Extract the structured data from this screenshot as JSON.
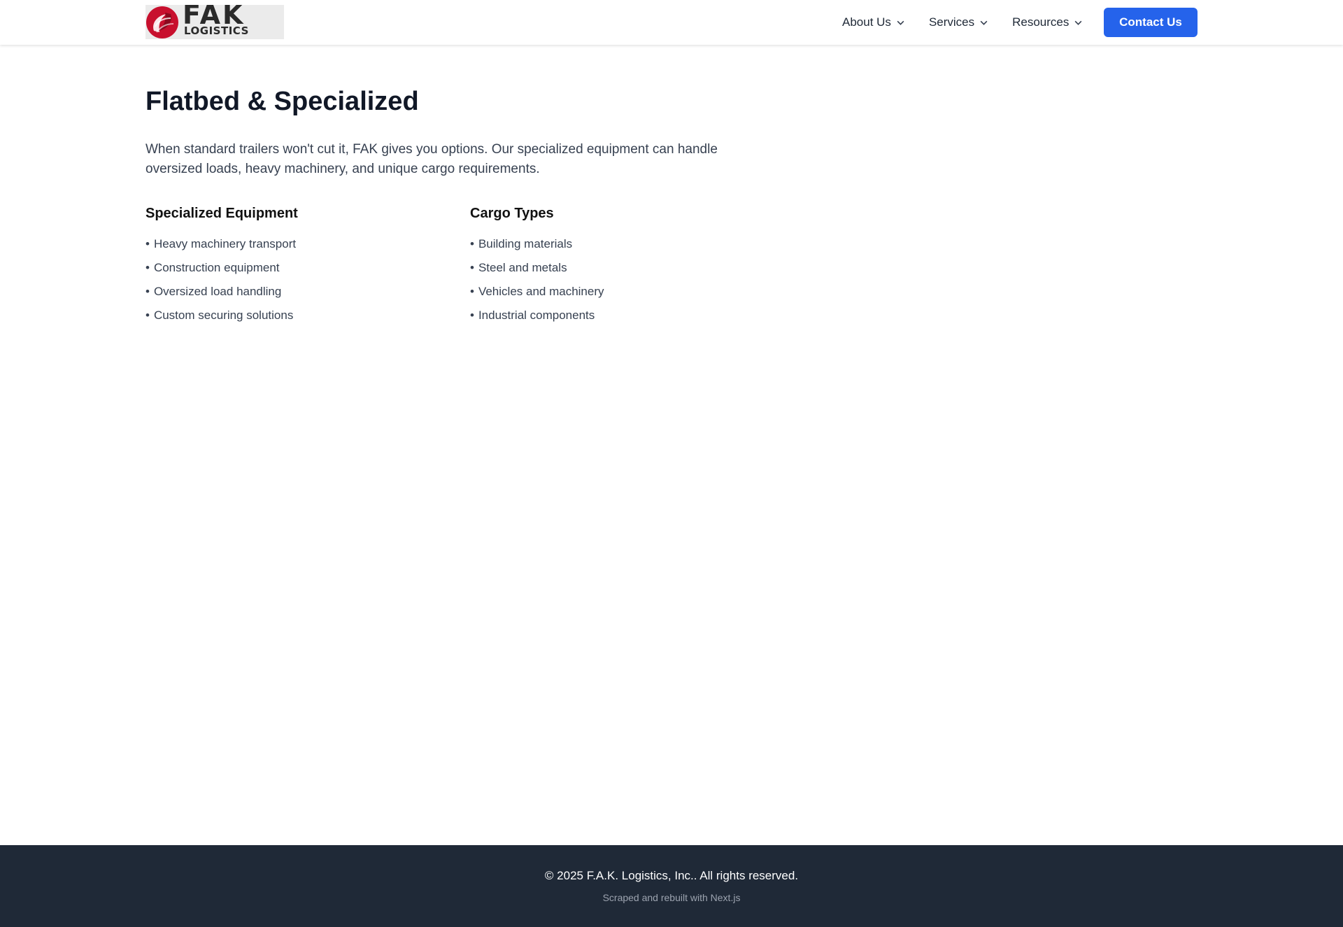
{
  "header": {
    "logo": {
      "main_text": "FAK",
      "sub_text": "LOGISTICS",
      "mark_color": "#c8102e",
      "background": "#ebebeb"
    },
    "nav": [
      {
        "label": "About Us",
        "icon": "chevron-down-icon"
      },
      {
        "label": "Services",
        "icon": "chevron-down-icon"
      },
      {
        "label": "Resources",
        "icon": "chevron-down-icon"
      }
    ],
    "contact_button": {
      "label": "Contact Us",
      "color": "#2563eb"
    }
  },
  "main": {
    "title": "Flatbed & Specialized",
    "intro": "When standard trailers won't cut it, FAK gives you options. Our specialized equipment can handle oversized loads, heavy machinery, and unique cargo requirements.",
    "sections": [
      {
        "heading": "Specialized Equipment",
        "items": [
          "Heavy machinery transport",
          "Construction equipment",
          "Oversized load handling",
          "Custom securing solutions"
        ]
      },
      {
        "heading": "Cargo Types",
        "items": [
          "Building materials",
          "Steel and metals",
          "Vehicles and machinery",
          "Industrial components"
        ]
      }
    ],
    "bullet": "•"
  },
  "footer": {
    "copyright": "© 2025 F.A.K. Logistics, Inc.. All rights reserved.",
    "note": "Scraped and rebuilt with Next.js",
    "background": "#1f2937"
  }
}
